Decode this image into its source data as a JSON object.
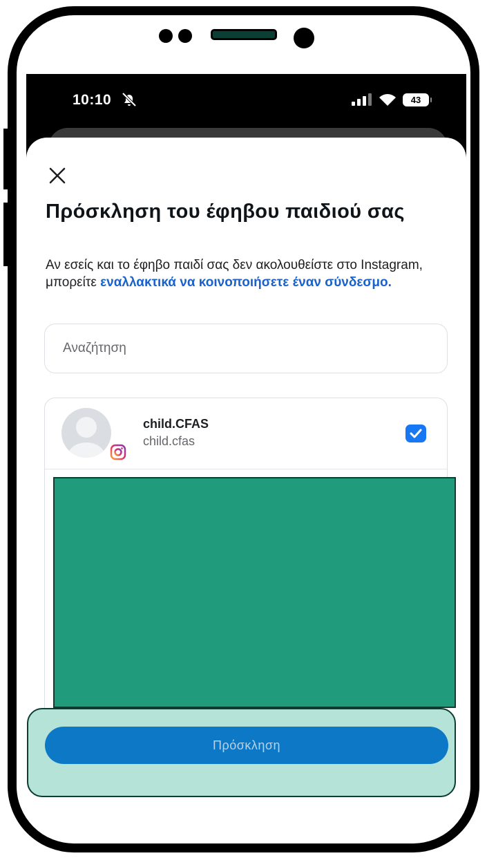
{
  "status_bar": {
    "time": "10:10",
    "battery": "43"
  },
  "sheet": {
    "title": "Πρόσκληση του έφηβου παιδιού σας",
    "description": "Αν εσείς και το έφηβο παιδί σας δεν ακολουθείστε στο Instagram, μπορείτε",
    "description_link": "εναλλακτικά να κοινοποιήσετε έναν σύνδεσμο."
  },
  "search": {
    "placeholder": "Αναζήτηση"
  },
  "accounts": [
    {
      "name": "child.CFAS",
      "handle": "child.cfas",
      "selected": true
    }
  ],
  "footer": {
    "invite_label": "Πρόσκληση"
  },
  "colors": {
    "accent": "#1877f2",
    "link": "#1a62c9",
    "button": "#0d78c6",
    "redaction": "#209b7b",
    "footer_highlight": "#b5e3d7"
  },
  "icons": [
    "close-icon",
    "bell-slash-icon",
    "signal-icon",
    "wifi-icon",
    "battery-icon",
    "instagram-icon",
    "checkbox-checked-icon"
  ]
}
